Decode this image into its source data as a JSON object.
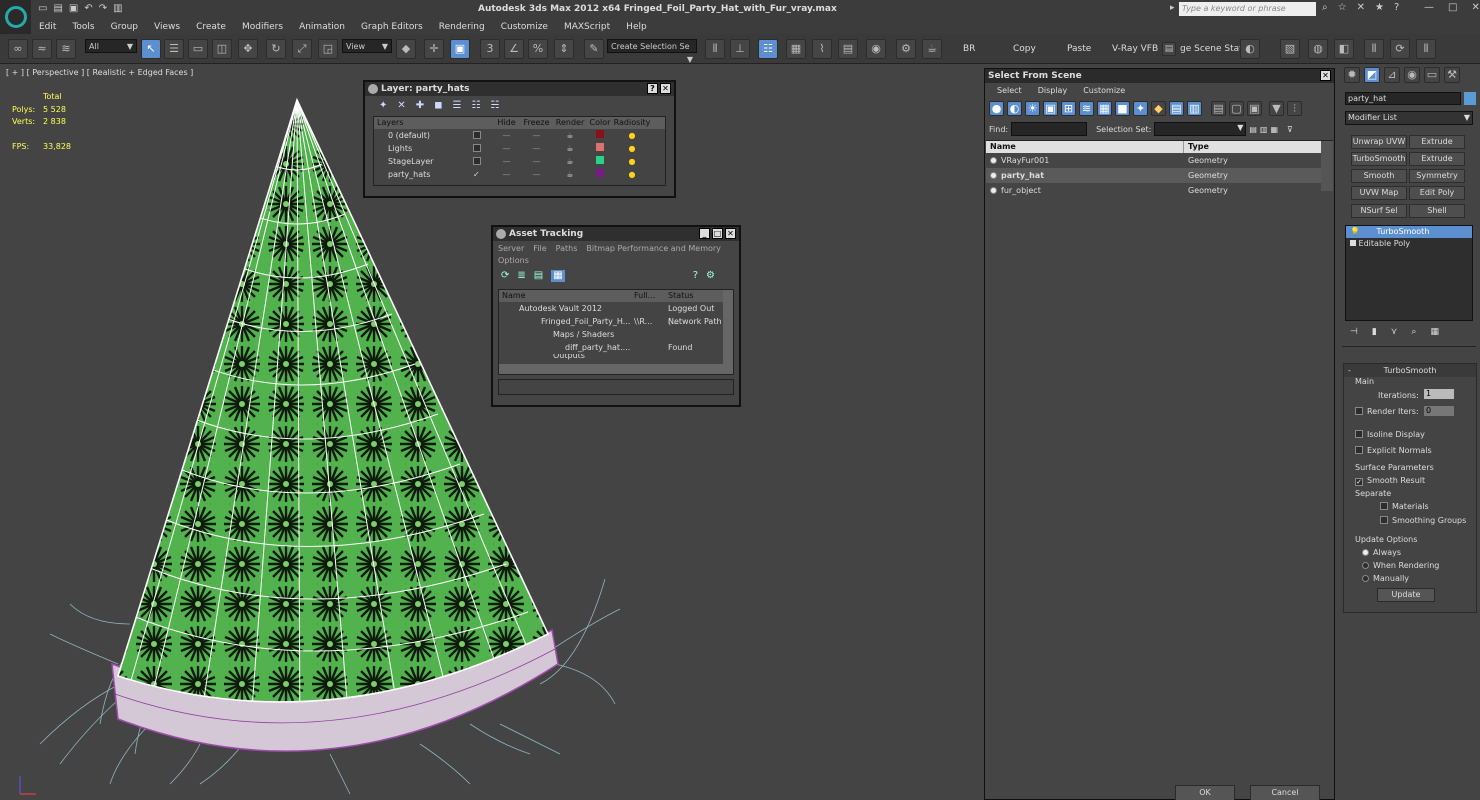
{
  "app": {
    "title": "Autodesk 3ds Max  2012 x64",
    "file": "Fringed_Foil_Party_Hat_with_Fur_vray.max",
    "search_placeholder": "Type a keyword or phrase"
  },
  "menu": [
    "Edit",
    "Tools",
    "Group",
    "Views",
    "Create",
    "Modifiers",
    "Animation",
    "Graph Editors",
    "Rendering",
    "Customize",
    "MAXScript",
    "Help"
  ],
  "toolbar": {
    "filter": "All",
    "ref_coord": "View",
    "selection_set": "Create Selection Se",
    "br": "BR",
    "copy": "Copy",
    "paste": "Paste",
    "vray_vfb": "V-Ray VFB",
    "scene_states": "ge Scene Stat"
  },
  "viewport": {
    "label": "[ + ] [ Perspective ] [ Realistic + Edged Faces ]",
    "stats_total": "Total",
    "polys_label": "Polys:",
    "polys_value": "5 528",
    "verts_label": "Verts:",
    "verts_value": "2 838",
    "fps_label": "FPS:",
    "fps_value": "33,828"
  },
  "layer_window": {
    "title": "Layer: party_hats",
    "columns": [
      "Layers",
      "Hide",
      "Freeze",
      "Render",
      "Color",
      "Radiosity"
    ],
    "rows": [
      {
        "name": "0 (default)",
        "color": "#8b0f1a"
      },
      {
        "name": "Lights",
        "color": "#e07070"
      },
      {
        "name": "StageLayer",
        "color": "#2fd08a"
      },
      {
        "name": "party_hats",
        "color": "#7a1a8a"
      }
    ]
  },
  "asset_tracking": {
    "title": "Asset Tracking",
    "menu": [
      "Server",
      "File",
      "Paths",
      "Bitmap Performance and Memory"
    ],
    "menu2": "Options",
    "columns": [
      "Name",
      "Full...",
      "Status"
    ],
    "rows": [
      {
        "name": "Autodesk Vault 2012",
        "full": "",
        "status": "Logged Out (..."
      },
      {
        "name": "Fringed_Foil_Party_H...",
        "full": "\\\\R...",
        "status": "Network Path"
      },
      {
        "name": "Maps / Shaders",
        "full": "",
        "status": ""
      },
      {
        "name": "diff_party_hat....",
        "full": "",
        "status": "Found"
      },
      {
        "name": "Outputs",
        "full": "",
        "status": ""
      }
    ]
  },
  "select_from_scene": {
    "title": "Select From Scene",
    "menu": [
      "Select",
      "Display",
      "Customize"
    ],
    "find_label": "Find:",
    "selset_label": "Selection Set:",
    "columns": [
      "Name",
      "Type"
    ],
    "rows": [
      {
        "name": "VRayFur001",
        "type": "Geometry"
      },
      {
        "name": "party_hat",
        "type": "Geometry"
      },
      {
        "name": "fur_object",
        "type": "Geometry"
      }
    ],
    "ok": "OK",
    "cancel": "Cancel"
  },
  "command_panel": {
    "object_name": "party_hat",
    "modifier_list": "Modifier List",
    "mod_buttons": [
      "Unwrap UVW",
      "Extrude",
      "TurboSmooth",
      "Extrude",
      "Smooth",
      "Symmetry",
      "UVW Map",
      "Edit Poly",
      "NSurf Sel",
      "Shell"
    ],
    "stack": [
      "TurboSmooth",
      "Editable Poly"
    ],
    "rollout_title": "TurboSmooth",
    "main_label": "Main",
    "iterations_label": "Iterations:",
    "iterations_value": "1",
    "render_iters_label": "Render Iters:",
    "render_iters_value": "0",
    "isoline": "Isoline Display",
    "explicit_normals": "Explicit Normals",
    "surface_params": "Surface Parameters",
    "smooth_result": "Smooth Result",
    "separate": "Separate",
    "materials": "Materials",
    "smoothing_groups": "Smoothing Groups",
    "update_options": "Update Options",
    "always": "Always",
    "when_rendering": "When Rendering",
    "manually": "Manually",
    "update": "Update"
  }
}
